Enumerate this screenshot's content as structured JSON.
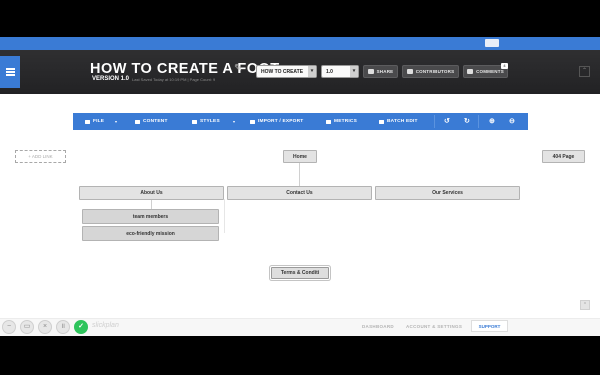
{
  "header": {
    "title": "HOW TO CREATE A FOOT",
    "version": "VERSION 1.0",
    "subinfo": "Last Saved Today at 10:19 PM  |  Page Count: 9",
    "page_select": "HOW TO CREATE",
    "version_select": "1.0",
    "share_label": "SHARE",
    "contributors_label": "CONTRIBUTORS",
    "comments_label": "COMMENTS",
    "comments_badge": "4"
  },
  "toolbar": {
    "file": "FILE",
    "content": "CONTENT",
    "styles": "STYLES",
    "import_export": "IMPORT / EXPORT",
    "metrics": "METRICS",
    "batch_edit": "BATCH EDIT",
    "undo_icon": "↺",
    "redo_icon": "↻",
    "zoom_in_icon": "⊕",
    "zoom_out_icon": "⊖"
  },
  "canvas": {
    "add_link": "+ ADD LINK",
    "home": "Home",
    "page_404": "404 Page",
    "about_us": "About Us",
    "contact_us": "Contact Us",
    "our_services": "Our Services",
    "team_members": "team members",
    "eco_mission": "eco-friendly mission",
    "terms": "Terms & Conditi"
  },
  "footer": {
    "wordmark": "slickplan",
    "link1": "DASHBOARD",
    "link2": "ACCOUNT & SETTINGS",
    "support": "SUPPORT"
  },
  "colors": {
    "accent": "#3a7bd5",
    "header_bg": "#2a2a2c",
    "node_bg": "#e3e3e3",
    "success": "#2ec45c"
  }
}
